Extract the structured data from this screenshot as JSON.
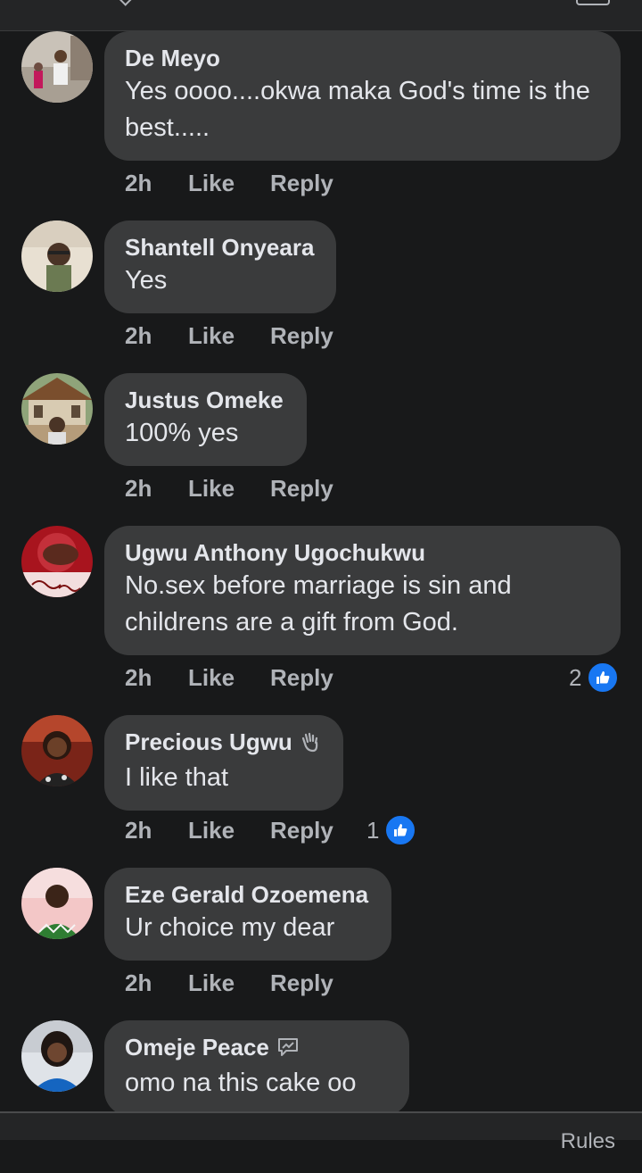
{
  "comments": [
    {
      "author": "De Meyo",
      "text": "Yes oooo....okwa maka God's time is the best.....",
      "time": "2h",
      "like_label": "Like",
      "reply_label": "Reply",
      "reactions": null
    },
    {
      "author": "Shantell Onyeara",
      "text": "Yes",
      "time": "2h",
      "like_label": "Like",
      "reply_label": "Reply",
      "reactions": null
    },
    {
      "author": "Justus Omeke",
      "text": "100% yes",
      "time": "2h",
      "like_label": "Like",
      "reply_label": "Reply",
      "reactions": null
    },
    {
      "author": "Ugwu Anthony Ugochukwu",
      "text": "No.sex before marriage is sin and childrens are a gift from God.",
      "time": "2h",
      "like_label": "Like",
      "reply_label": "Reply",
      "reactions": "2"
    },
    {
      "author": "Precious Ugwu",
      "text": "I like that",
      "time": "2h",
      "like_label": "Like",
      "reply_label": "Reply",
      "reactions": "1",
      "badge": "wave-icon"
    },
    {
      "author": "Eze Gerald Ozoemena",
      "text": "Ur choice my dear",
      "time": "2h",
      "like_label": "Like",
      "reply_label": "Reply",
      "reactions": null
    },
    {
      "author": "Omeje Peace",
      "text": "omo na this cake oo",
      "badge": "chat-bubble-icon"
    }
  ],
  "footer": {
    "rules_text": "Rules"
  },
  "colors": {
    "background": "#18191a",
    "bubble": "#3a3b3c",
    "like_blue": "#1877f2",
    "secondary_text": "#b0b3b8"
  }
}
